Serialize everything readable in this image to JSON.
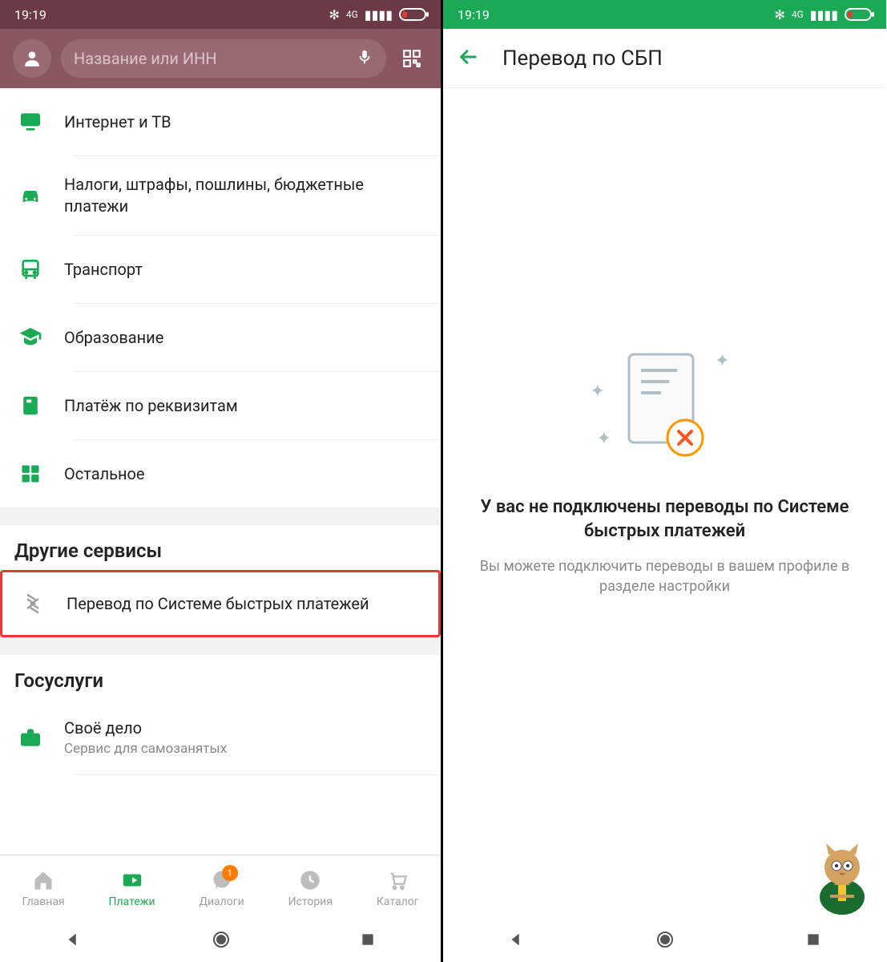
{
  "status": {
    "time": "19:19",
    "net": "4G"
  },
  "left": {
    "search_placeholder": "Название или ИНН",
    "categories": [
      {
        "icon": "tv",
        "label": "Интернет и ТВ"
      },
      {
        "icon": "car",
        "label": "Налоги, штрафы, пошлины, бюджетные платежи"
      },
      {
        "icon": "bus",
        "label": "Транспорт"
      },
      {
        "icon": "grad",
        "label": "Образование"
      },
      {
        "icon": "doc",
        "label": "Платёж по реквизитам"
      },
      {
        "icon": "grid",
        "label": "Остальное"
      }
    ],
    "sections": {
      "other_services": "Другие сервисы",
      "sbp": "Перевод по Системе быстрых платежей",
      "gosuslugi": "Госуслуги",
      "own_biz": {
        "title": "Своё дело",
        "sub": "Сервис для самозанятых"
      }
    },
    "nav": {
      "home": "Главная",
      "payments": "Платежи",
      "dialogs": "Диалоги",
      "history": "История",
      "catalog": "Каталог",
      "badge": "1"
    }
  },
  "right": {
    "title": "Перевод по СБП",
    "empty_title": "У вас не подключены переводы по Системе быстрых платежей",
    "empty_sub": "Вы можете подключить переводы в вашем профиле в разделе настройки"
  }
}
